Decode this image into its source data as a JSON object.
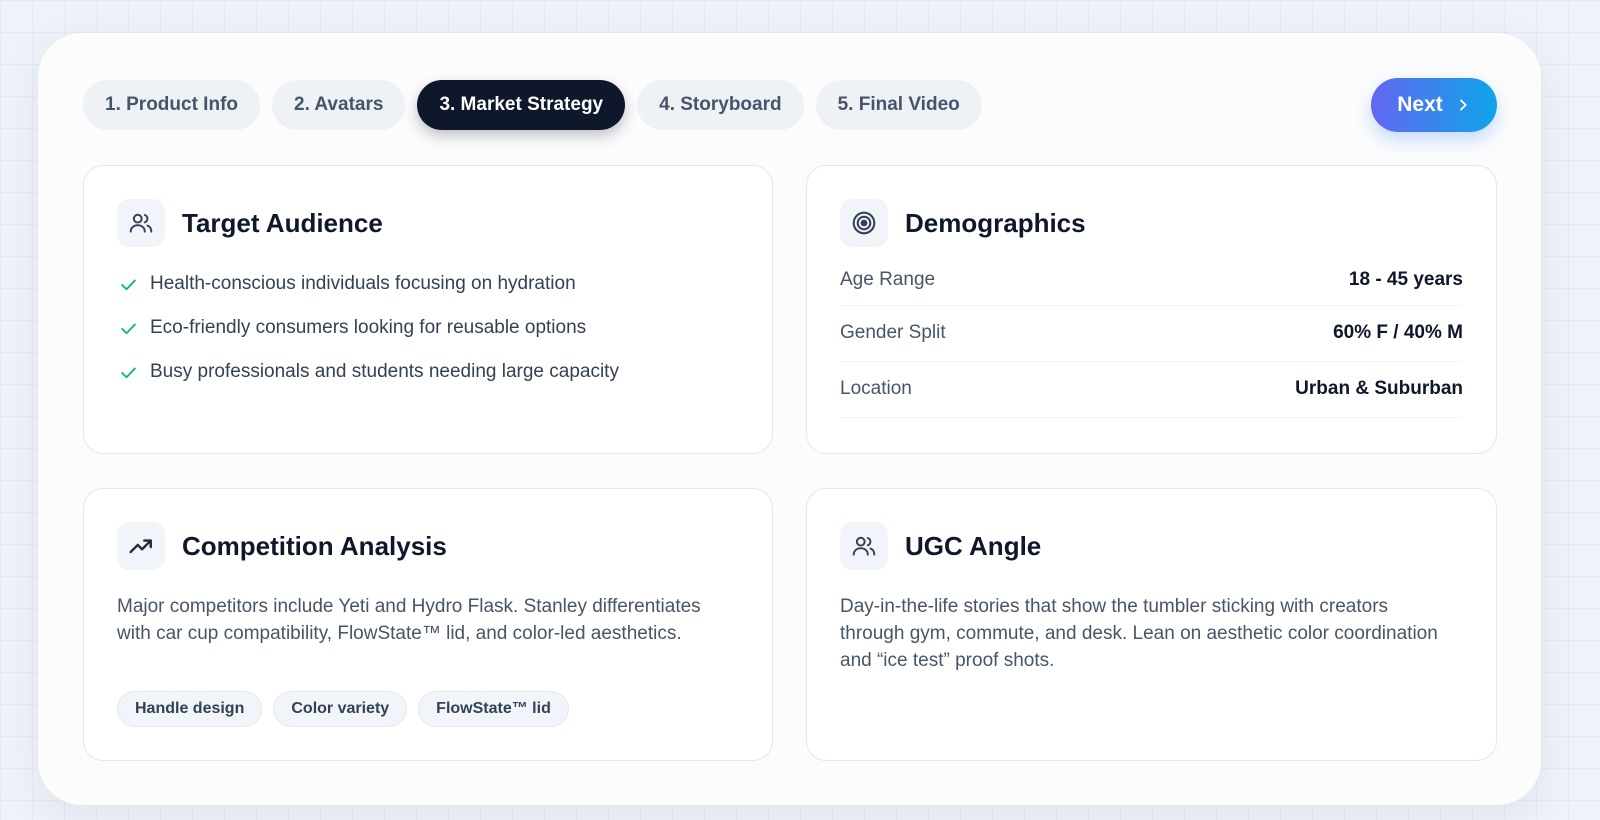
{
  "steps": [
    {
      "label": "1. Product Info",
      "active": false
    },
    {
      "label": "2. Avatars",
      "active": false
    },
    {
      "label": "3. Market Strategy",
      "active": true
    },
    {
      "label": "4. Storyboard",
      "active": false
    },
    {
      "label": "5. Final Video",
      "active": false
    }
  ],
  "next_button": {
    "label": "Next",
    "icon": "chevron-right-icon"
  },
  "colors": {
    "active_step_bg": "#0f172a",
    "next_gradient_start": "#6366f1",
    "next_gradient_end": "#0ea5e9",
    "check": "#10b981"
  },
  "target_audience": {
    "title": "Target Audience",
    "icon": "users-icon",
    "items": [
      "Health-conscious individuals focusing on hydration",
      "Eco-friendly consumers looking for reusable options",
      "Busy professionals and students needing large capacity"
    ]
  },
  "demographics": {
    "title": "Demographics",
    "icon": "target-icon",
    "rows": [
      {
        "label": "Age Range",
        "value": "18 - 45 years"
      },
      {
        "label": "Gender Split",
        "value": "60% F / 40% M"
      },
      {
        "label": "Location",
        "value": "Urban & Suburban"
      }
    ]
  },
  "competition": {
    "title": "Competition Analysis",
    "icon": "trending-up-icon",
    "text": "Major competitors include Yeti and Hydro Flask. Stanley differentiates with car cup compatibility, FlowState™ lid, and color-led aesthetics.",
    "tags": [
      "Handle design",
      "Color variety",
      "FlowState™ lid"
    ]
  },
  "ugc_angle": {
    "title": "UGC Angle",
    "icon": "users-icon",
    "text": "Day-in-the-life stories that show the tumbler sticking with creators through gym, commute, and desk. Lean on aesthetic color coordination and “ice test” proof shots."
  }
}
